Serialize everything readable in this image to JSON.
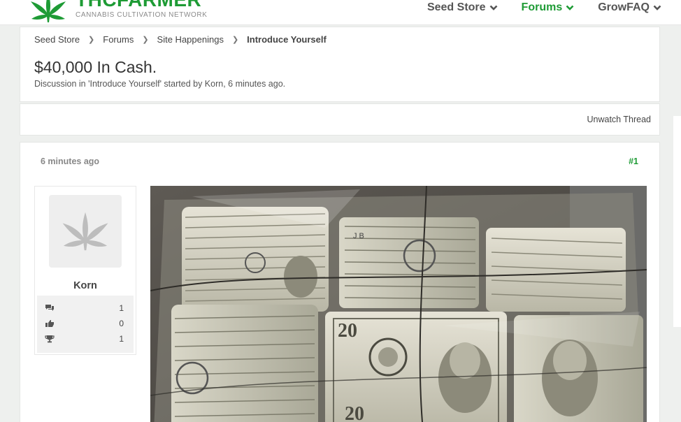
{
  "header": {
    "logo_text_part1": "THC",
    "logo_text_part2": "FARMER",
    "logo_tagline": "CANNABIS CULTIVATION NETWORK",
    "nav": [
      {
        "label": "Seed Store",
        "active": false
      },
      {
        "label": "Forums",
        "active": true
      },
      {
        "label": "GrowFAQ",
        "active": false
      }
    ]
  },
  "breadcrumb": [
    "Seed Store",
    "Forums",
    "Site Happenings",
    "Introduce Yourself"
  ],
  "thread": {
    "title": "$40,000 In Cash.",
    "subtitle": "Discussion in 'Introduce Yourself' started by Korn, 6 minutes ago.",
    "unwatch_label": "Unwatch Thread"
  },
  "post": {
    "time": "6 minutes ago",
    "number": "#1",
    "user": {
      "name": "Korn",
      "messages": "1",
      "likes": "0",
      "trophies": "1"
    },
    "image_alt": "photo of bundled $20 bills"
  },
  "colors": {
    "accent": "#1e9b35",
    "text": "#333333",
    "muted": "#888888"
  }
}
